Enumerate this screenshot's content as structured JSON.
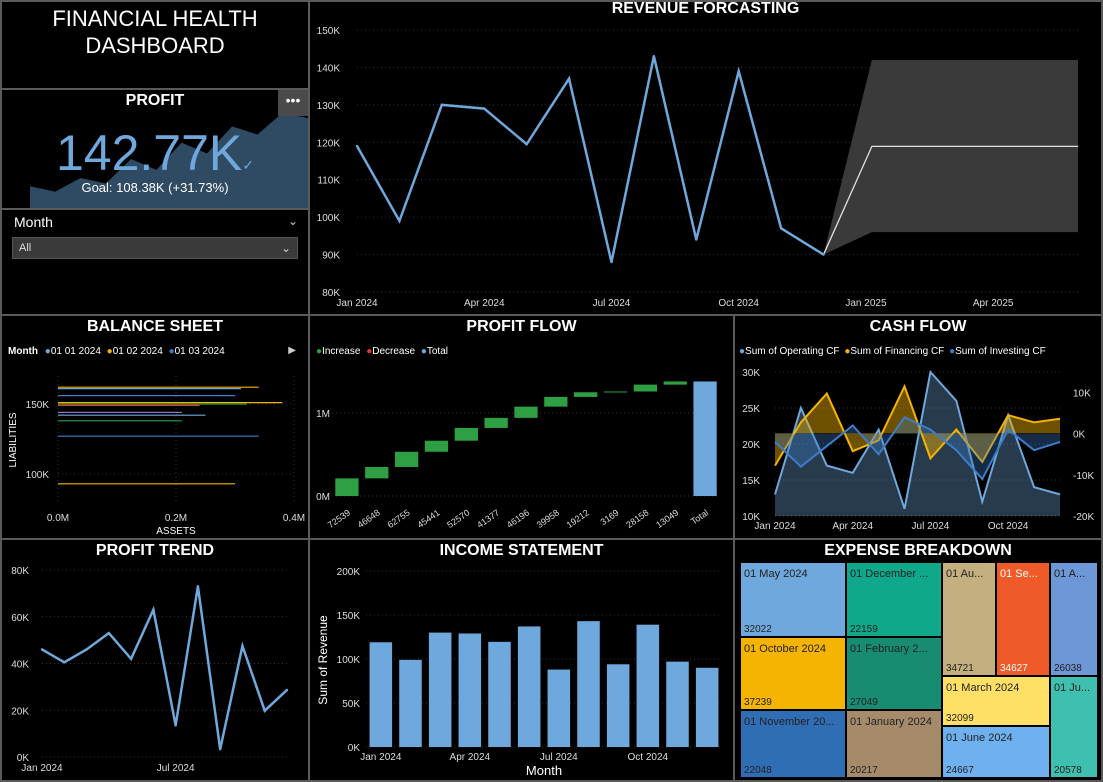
{
  "header": {
    "title_line1": "FINANCIAL HEALTH",
    "title_line2": "DASHBOARD"
  },
  "kpi": {
    "title": "PROFIT",
    "value": "142.77K",
    "check": "✓",
    "goal": "Goal: 108.38K (+31.73%)",
    "menu": "•••",
    "trend_values": [
      40,
      30,
      55,
      45,
      90,
      70,
      120,
      100,
      150,
      135,
      175,
      165
    ],
    "colors": {
      "value": "#6fa8dc",
      "area": "#2f4a63"
    }
  },
  "slicer": {
    "label": "Month",
    "selected": "All"
  },
  "revenue_forecast": {
    "title": "REVENUE FORCASTING",
    "chart_data": {
      "type": "line",
      "x": [
        "2024-01",
        "2024-02",
        "2024-03",
        "2024-04",
        "2024-05",
        "2024-06",
        "2024-07",
        "2024-08",
        "2024-09",
        "2024-10",
        "2024-11",
        "2024-12"
      ],
      "values": [
        119,
        99,
        130,
        129,
        119.5,
        137,
        88,
        143,
        94,
        139,
        97,
        90
      ],
      "forecast": {
        "x_start": "2024-12",
        "x_end": "2025-06",
        "start": 90,
        "value": 118.9,
        "upper": 142,
        "lower": 96
      },
      "y_ticks": [
        "80K",
        "90K",
        "100K",
        "110K",
        "120K",
        "130K",
        "140K",
        "150K"
      ],
      "x_ticks": [
        "Jan 2024",
        "Apr 2024",
        "Jul 2024",
        "Oct 2024",
        "Jan 2025",
        "Apr 2025"
      ],
      "ylim": [
        80,
        150
      ],
      "colors": {
        "line": "#6fa8dc",
        "band": "#3a3a3a",
        "forecast": "#e0e0e0"
      }
    }
  },
  "balance_sheet": {
    "title": "BALANCE SHEET",
    "legend": {
      "title": "Month",
      "items": [
        {
          "label": "01 01 2024",
          "color": "#6fa8dc"
        },
        {
          "label": "01 02 2024",
          "color": "#f4b400"
        },
        {
          "label": "01 03 2024",
          "color": "#3d7cc9"
        }
      ]
    },
    "ylabel": "LIABILITIES",
    "xlabel": "ASSETS",
    "y_ticks": [
      "150K",
      "100K"
    ],
    "x_ticks": [
      "0.0M",
      "0.2M",
      "0.4M"
    ],
    "chart_data": {
      "type": "scatter",
      "segments": [
        {
          "liabilities": 162,
          "assets_start": 0.0,
          "assets_end": 0.34,
          "color": "#f4b400"
        },
        {
          "liabilities": 161,
          "assets_start": 0.0,
          "assets_end": 0.31,
          "color": "#6fa8dc"
        },
        {
          "liabilities": 156,
          "assets_start": 0.0,
          "assets_end": 0.3,
          "color": "#3d7cc9"
        },
        {
          "liabilities": 151,
          "assets_start": 0.0,
          "assets_end": 0.38,
          "color": "#f4b400"
        },
        {
          "liabilities": 150,
          "assets_start": 0.0,
          "assets_end": 0.32,
          "color": "#2ea043"
        },
        {
          "liabilities": 149,
          "assets_start": 0.0,
          "assets_end": 0.24,
          "color": "#e53935"
        },
        {
          "liabilities": 144,
          "assets_start": 0.0,
          "assets_end": 0.21,
          "color": "#8e6fc9"
        },
        {
          "liabilities": 142,
          "assets_start": 0.0,
          "assets_end": 0.25,
          "color": "#6fa8dc"
        },
        {
          "liabilities": 138,
          "assets_start": 0.0,
          "assets_end": 0.21,
          "color": "#2ea043"
        },
        {
          "liabilities": 127,
          "assets_start": 0.0,
          "assets_end": 0.34,
          "color": "#3d7cc9"
        },
        {
          "liabilities": 93,
          "assets_start": 0.0,
          "assets_end": 0.3,
          "color": "#f4b400"
        }
      ],
      "xlim": [
        0,
        0.4
      ],
      "ylim": [
        80,
        170
      ]
    }
  },
  "profit_flow": {
    "title": "PROFIT FLOW",
    "legend": [
      {
        "label": "Increase",
        "color": "#2ea043"
      },
      {
        "label": "Decrease",
        "color": "#e53935"
      },
      {
        "label": "Total",
        "color": "#6fa8dc"
      }
    ],
    "y_ticks": [
      "1M",
      "0M"
    ],
    "chart_data": {
      "type": "bar",
      "categories": [
        "72539",
        "46648",
        "62755",
        "45441",
        "52570",
        "41377",
        "46196",
        "39958",
        "19212",
        "3169",
        "28158",
        "13049",
        "Total"
      ],
      "values": [
        72539,
        46648,
        62755,
        45441,
        52570,
        41377,
        46196,
        39958,
        19212,
        3169,
        28158,
        13049,
        1380000
      ]
    }
  },
  "cash_flow": {
    "title": "CASH FLOW",
    "legend": [
      {
        "label": "Sum of Operating CF",
        "color": "#6fa8dc"
      },
      {
        "label": "Sum of Financing CF",
        "color": "#f4b400"
      },
      {
        "label": "Sum of Investing CF",
        "color": "#3d7cc9"
      }
    ],
    "chart_data": {
      "type": "area",
      "x": [
        "Jan 2024",
        "Feb 2024",
        "Mar 2024",
        "Apr 2024",
        "May 2024",
        "Jun 2024",
        "Jul 2024",
        "Aug 2024",
        "Sep 2024",
        "Oct 2024",
        "Nov 2024",
        "Dec 2024"
      ],
      "series": [
        {
          "name": "Sum of Operating CF",
          "values": [
            13000,
            25000,
            17000,
            16000,
            22000,
            11000,
            30000,
            26000,
            12000,
            24000,
            14000,
            13000
          ],
          "axis": "left"
        },
        {
          "name": "Sum of Financing CF",
          "values": [
            17000,
            23000,
            27000,
            19000,
            20500,
            28000,
            18000,
            22000,
            17500,
            24000,
            23000,
            23500
          ],
          "axis": "left"
        },
        {
          "name": "Sum of Investing CF",
          "values": [
            -2000,
            -8000,
            -3000,
            2000,
            -5000,
            4000,
            1000,
            -4000,
            -11000,
            1000,
            -4000,
            -2000
          ],
          "axis": "right"
        }
      ],
      "y_ticks_left": [
        "30K",
        "25K",
        "20K",
        "15K",
        "10K"
      ],
      "y_ticks_right": [
        "10K",
        "0K",
        "-10K",
        "-20K"
      ],
      "x_ticks": [
        "Jan 2024",
        "Apr 2024",
        "Jul 2024",
        "Oct 2024"
      ],
      "ylim_left": [
        10000,
        30000
      ],
      "ylim_right": [
        -20000,
        15000
      ]
    }
  },
  "profit_trend": {
    "title": "PROFIT TREND",
    "chart_data": {
      "type": "line",
      "x": [
        "Jan 2024",
        "Feb 2024",
        "Mar 2024",
        "Apr 2024",
        "May 2024",
        "Jun 2024",
        "Jul 2024",
        "Aug 2024",
        "Sep 2024",
        "Oct 2024",
        "Nov 2024",
        "Dec 2024"
      ],
      "values": [
        46000,
        40500,
        46000,
        53000,
        42000,
        63000,
        13500,
        73000,
        3300,
        47500,
        19800,
        28700
      ],
      "y_ticks": [
        "80K",
        "60K",
        "40K",
        "20K",
        "0K"
      ],
      "x_ticks": [
        "Jan 2024",
        "Jul 2024"
      ],
      "ylim": [
        0,
        80000
      ],
      "color": "#6fa8dc"
    }
  },
  "income_statement": {
    "title": "INCOME STATEMENT",
    "ylabel": "Sum of Revenue",
    "xlabel": "Month",
    "chart_data": {
      "type": "bar",
      "categories": [
        "Jan 2024",
        "Feb 2024",
        "Mar 2024",
        "Apr 2024",
        "May 2024",
        "Jun 2024",
        "Jul 2024",
        "Aug 2024",
        "Sep 2024",
        "Oct 2024",
        "Nov 2024",
        "Dec 2024"
      ],
      "values": [
        119000,
        99000,
        130000,
        129000,
        119500,
        137000,
        88000,
        143000,
        94000,
        139000,
        97000,
        90000
      ],
      "y_ticks": [
        "200K",
        "150K",
        "100K",
        "50K",
        "0K"
      ],
      "x_ticks": [
        "Jan 2024",
        "Apr 2024",
        "Jul 2024",
        "Oct 2024"
      ],
      "ylim": [
        0,
        200000
      ],
      "color": "#6fa8dc"
    }
  },
  "expense_breakdown": {
    "title": "EXPENSE BREAKDOWN",
    "tiles": [
      {
        "label": "01 May 2024",
        "value": "32022",
        "color": "#6fa8dc",
        "dark": true
      },
      {
        "label": "01 October 2024",
        "value": "37239",
        "color": "#f4b400",
        "dark": true
      },
      {
        "label": "01 November 20...",
        "value": "22048",
        "color": "#2f6db5",
        "dark": true
      },
      {
        "label": "01 December ...",
        "value": "22159",
        "color": "#10a88a",
        "dark": true
      },
      {
        "label": "01 February 2...",
        "value": "27049",
        "color": "#188c70",
        "dark": true
      },
      {
        "label": "01 January 2024",
        "value": "20217",
        "color": "#a68b6a",
        "dark": true
      },
      {
        "label": "01 Au...",
        "value": "34721",
        "color": "#c4b07e",
        "dark": true
      },
      {
        "label": "01 Se...",
        "value": "34627",
        "color": "#f05a28",
        "dark": false
      },
      {
        "label": "01 A...",
        "value": "26038",
        "color": "#6d97d6",
        "dark": true
      },
      {
        "label": "01 March 2024",
        "value": "32099",
        "color": "#ffe066",
        "dark": true
      },
      {
        "label": "01 Ju...",
        "value": "20578",
        "color": "#3fbfb0",
        "dark": true
      },
      {
        "label": "01 June 2024",
        "value": "24667",
        "color": "#6fb0ef",
        "dark": true
      }
    ]
  }
}
